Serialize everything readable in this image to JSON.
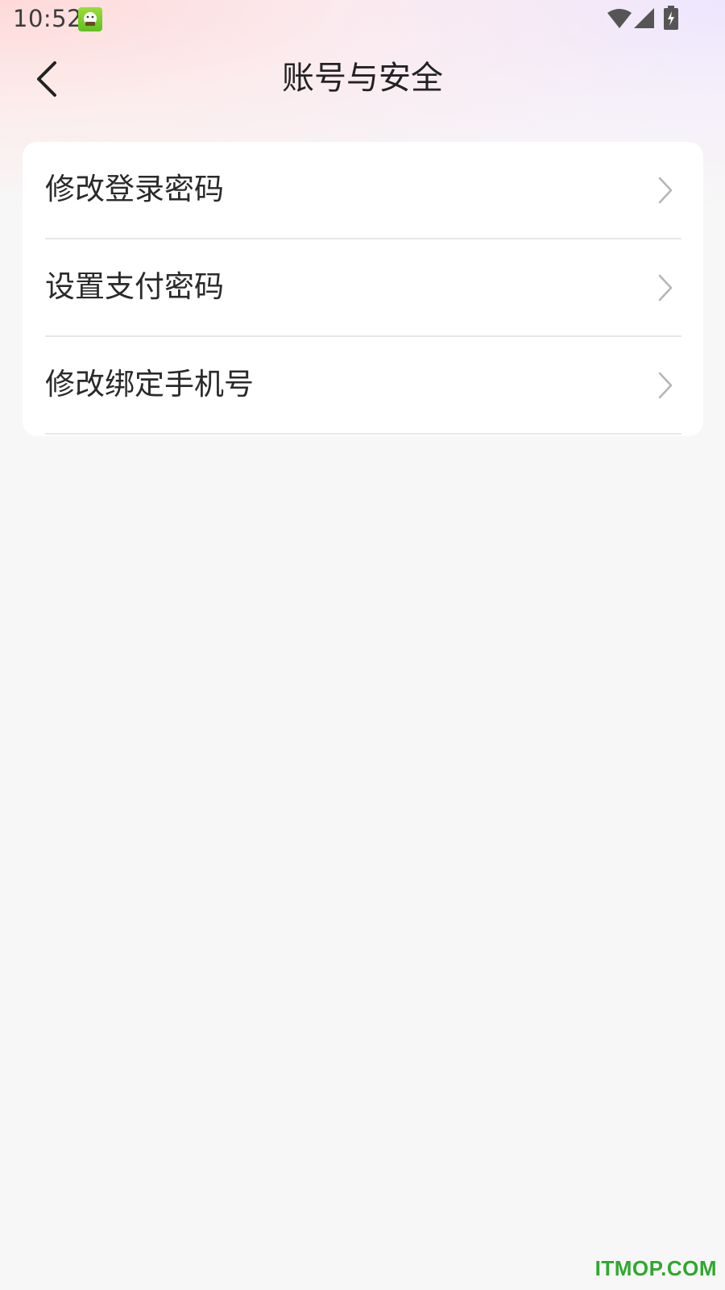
{
  "status_bar": {
    "time": "10:52",
    "notification_icon": "app-mascot-icon",
    "wifi_icon": "wifi-icon",
    "signal_icon": "cell-signal-icon",
    "battery_icon": "battery-charging-icon"
  },
  "header": {
    "back_icon": "chevron-left-icon",
    "title": "账号与安全"
  },
  "settings": {
    "items": [
      {
        "label": "修改登录密码",
        "icon": "chevron-right-icon"
      },
      {
        "label": "设置支付密码",
        "icon": "chevron-right-icon"
      },
      {
        "label": "修改绑定手机号",
        "icon": "chevron-right-icon"
      }
    ]
  },
  "watermark": "ITMOP.COM",
  "colors": {
    "background": "#f7f7f7",
    "card": "#ffffff",
    "text": "#222222",
    "chevron": "#b5b5b5",
    "watermark": "#2ea82e"
  }
}
